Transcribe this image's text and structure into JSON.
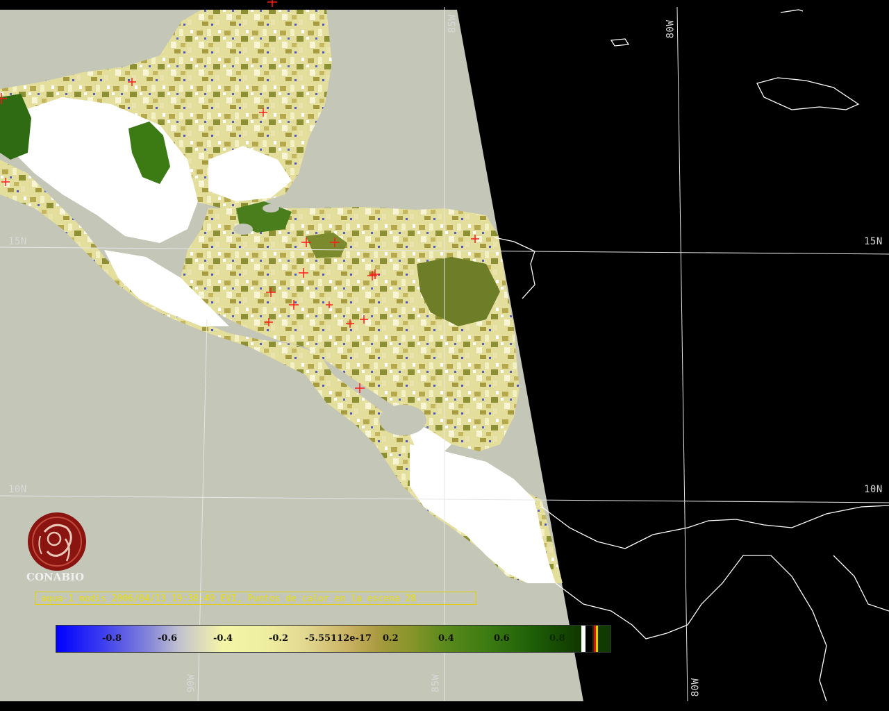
{
  "map": {
    "colors": {
      "ocean_scene": "#c4c6b8",
      "outside_scene": "#000000",
      "land_cloud": "#ffffff",
      "grid_line": "#e6e6e6",
      "hotspot": "#ff1a1a",
      "veg_dark": "#2e6b12",
      "veg_mid": "#9a9a3a",
      "veg_light": "#e6e2a0"
    },
    "grid_labels": {
      "lat15_left": "15N",
      "lat15_right": "15N",
      "lat10_left": "10N",
      "lat10_right": "10N",
      "lon85_top": "85W",
      "lon80_top": "80W",
      "lon90_bottom": "90W",
      "lon85_bottom": "85W",
      "lon80_bottom": "80W"
    }
  },
  "logo": {
    "text": "CONABIO",
    "icon": "conabio-seal-icon"
  },
  "caption": "aqua-1 modis 2006/04/13 19:38:49 EVI, Puntos de calor en la escena 28",
  "legend": {
    "ticks": [
      "-0.8",
      "-0.6",
      "-0.4",
      "-0.2",
      "-5.55112e-17",
      "0.2",
      "0.4",
      "0.6",
      "0.8"
    ]
  }
}
